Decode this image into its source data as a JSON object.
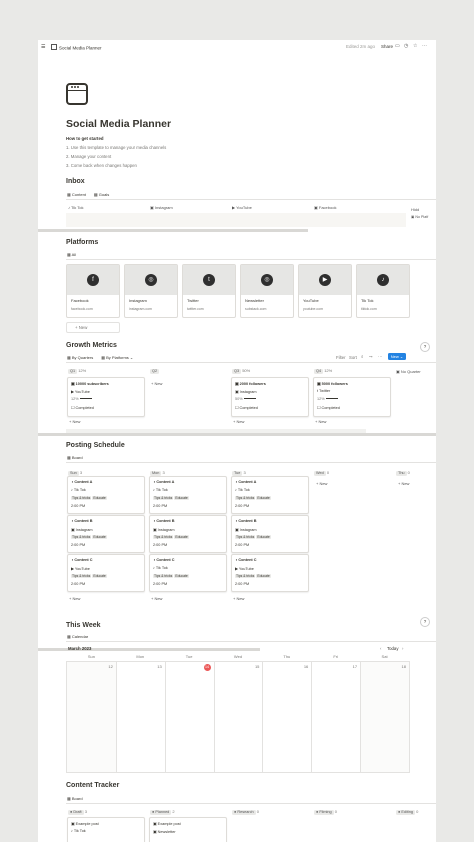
{
  "topbar": {
    "title": "Social Media Planner",
    "edited": "Edited 2m ago",
    "share": "Share"
  },
  "page": {
    "title": "Social Media Planner",
    "how_title": "How to get started",
    "steps": [
      "1.  Use this template to manage your media channels",
      "2.  Manage your content",
      "3.  Come back when changes happen"
    ]
  },
  "inbox": {
    "title": "Inbox",
    "tabs": [
      "Content",
      "Goals"
    ],
    "columns": [
      "Tik Tok",
      "Instagram",
      "YouTube",
      "Facebook"
    ],
    "hidden_label": "Hidd",
    "no_platform": "No Platf"
  },
  "platforms": {
    "title": "Platforms",
    "tab": "All",
    "new_label": "+ New",
    "items": [
      {
        "name": "Facebook",
        "url": "facebook.com",
        "glyph": "f"
      },
      {
        "name": "Instagram",
        "url": "instagram.com",
        "glyph": "◎"
      },
      {
        "name": "Twitter",
        "url": "twitter.com",
        "glyph": "t"
      },
      {
        "name": "Newsletter",
        "url": "substack.com",
        "glyph": "◎"
      },
      {
        "name": "YouTube",
        "url": "youtube.com",
        "glyph": "▶"
      },
      {
        "name": "Tik Tok",
        "url": "tiktok.com",
        "glyph": "♪"
      }
    ]
  },
  "growth": {
    "title": "Growth Metrics",
    "tabs": [
      "By Quarters",
      "By Platforms"
    ],
    "toolbar": [
      "Filter",
      "Sort"
    ],
    "new_label": "New",
    "groups": [
      {
        "name": "Q1",
        "pct": "12%"
      },
      {
        "name": "Q2",
        "pct": ""
      },
      {
        "name": "Q3",
        "pct": "50%"
      },
      {
        "name": "Q4",
        "pct": "12%"
      },
      {
        "name": "No Quarter",
        "pct": ""
      }
    ],
    "cards": [
      {
        "title": "10000 subscribers",
        "platform": "YouTube",
        "pct": "12%",
        "status": "Completed"
      },
      {
        "title": "2000 followers",
        "platform": "Instagram",
        "pct": "50%",
        "status": "Completed"
      },
      {
        "title": "5000 followers",
        "platform": "Twitter",
        "pct": "12%",
        "status": "Completed"
      }
    ],
    "new_item": "+ New"
  },
  "schedule": {
    "title": "Posting Schedule",
    "tab": "Board",
    "days": [
      {
        "name": "Sun",
        "count": "3"
      },
      {
        "name": "Mon",
        "count": "3"
      },
      {
        "name": "Tue",
        "count": "3"
      },
      {
        "name": "Wed",
        "count": "0"
      },
      {
        "name": "Thu",
        "count": "0"
      }
    ],
    "rows": [
      {
        "title": "Content A",
        "platform": "Tik Tok"
      },
      {
        "title": "Content B",
        "platform": "Instagram"
      },
      {
        "title": "Content C",
        "platform": "YouTube"
      }
    ],
    "row_platforms_mon": [
      "Tik Tok",
      "Instagram",
      "Tik Tok"
    ],
    "tags": [
      "Tips & tricks",
      "Educate"
    ],
    "time": "2:00 PM",
    "new_item": "+ New"
  },
  "week": {
    "title": "This Week",
    "tab": "Calendar",
    "month": "March 2023",
    "today": "Today",
    "weekdays": [
      "Sun",
      "Mon",
      "Tue",
      "Wed",
      "Thu",
      "Fri",
      "Sat"
    ],
    "dates": [
      "12",
      "13",
      "14",
      "15",
      "16",
      "17",
      "18"
    ]
  },
  "tracker": {
    "title": "Content Tracker",
    "tab": "Board",
    "groups": [
      {
        "name": "Draft",
        "count": "3"
      },
      {
        "name": "Planned",
        "count": "2"
      },
      {
        "name": "Research",
        "count": "0"
      },
      {
        "name": "Filming",
        "count": "0"
      },
      {
        "name": "Editing",
        "count": "0"
      }
    ],
    "draft_items": [
      "Example post",
      "Tik Tok"
    ],
    "planned_items": [
      "Example post",
      "Newsletter"
    ]
  },
  "colors": {
    "accent": "#2383e2",
    "today": "#eb5757",
    "page_bg": "#ffffff",
    "outer_bg": "#e9e9e7"
  }
}
